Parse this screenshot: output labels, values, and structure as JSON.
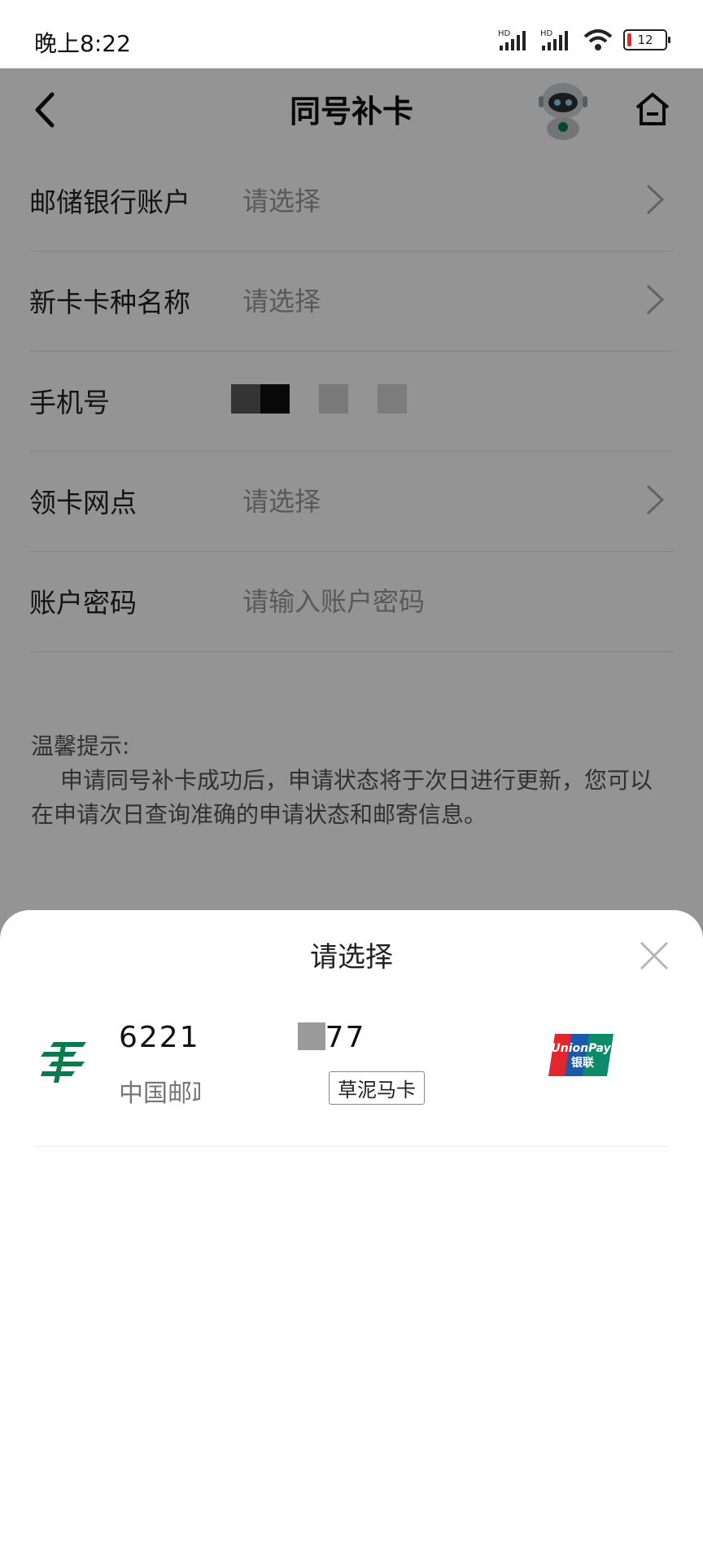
{
  "status_bar": {
    "time": "晚上8:22",
    "signal1_label": "HD",
    "signal2_label": "HD",
    "battery": "12"
  },
  "header": {
    "title": "同号补卡"
  },
  "form": {
    "rows": [
      {
        "label": "邮储银行账户",
        "value": "请选择",
        "chevron": true
      },
      {
        "label": "新卡卡种名称",
        "value": "请选择",
        "chevron": true
      },
      {
        "label": "手机号",
        "value": "",
        "chevron": false
      },
      {
        "label": "领卡网点",
        "value": "请选择",
        "chevron": true
      },
      {
        "label": "账户密码",
        "placeholder": "请输入账户密码",
        "chevron": false
      }
    ]
  },
  "tips": {
    "title": "温馨提示:",
    "body": "申请同号补卡成功后，申请状态将于次日进行更新，您可以在申请次日查询准确的申请状态和邮寄信息。"
  },
  "sheet": {
    "title": "请选择",
    "cards": [
      {
        "number_prefix": "6221",
        "number_suffix": "77",
        "bank_name": "中国邮政",
        "card_tag": "草泥马卡",
        "network": "UnionPay 银联"
      }
    ]
  },
  "colors": {
    "overlay": "#000000",
    "post_green": "#0b7a4f",
    "unionpay_red": "#e1262d",
    "unionpay_blue": "#1c5aa8",
    "unionpay_green": "#0e8a6b"
  }
}
